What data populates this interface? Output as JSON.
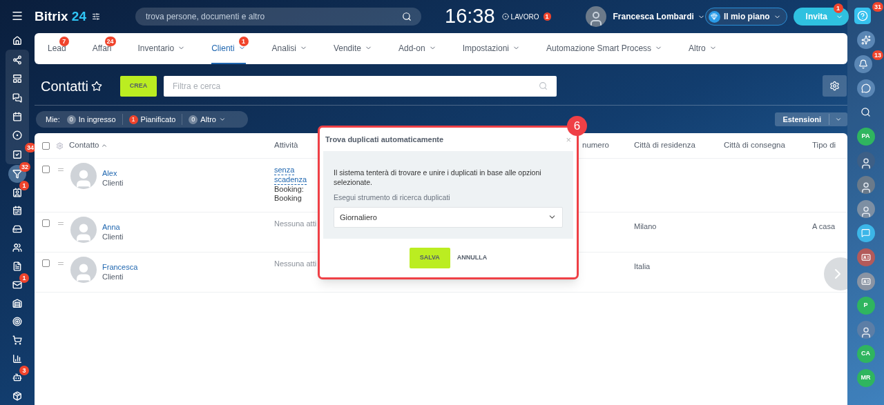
{
  "header": {
    "logo_name": "Bitrix",
    "logo_number": "24",
    "search_placeholder": "trova persone, documenti e altro",
    "clock": "16:38",
    "work_status": {
      "label": "LAVORO",
      "badge": "1"
    },
    "user_name": "Francesca Lombardi",
    "plan_button": "Il mio piano",
    "invite_button": {
      "label": "Invita",
      "badge": "1"
    }
  },
  "left_sidebar": {
    "top": [
      {
        "kind": "home",
        "selected": false
      }
    ],
    "pinned": [
      {
        "kind": "flow",
        "selected": false
      },
      {
        "kind": "board",
        "selected": false
      },
      {
        "kind": "chat",
        "selected": false
      },
      {
        "kind": "calendar",
        "selected": false
      },
      {
        "kind": "circle",
        "selected": false
      },
      {
        "kind": "tasks",
        "badge": "34",
        "selected": false
      }
    ],
    "rest": [
      {
        "kind": "funnel",
        "badge": "32",
        "selected": true
      },
      {
        "kind": "contact",
        "badge": "1",
        "selected": false
      },
      {
        "kind": "schedule",
        "selected": false
      },
      {
        "kind": "drive",
        "selected": false
      },
      {
        "kind": "group",
        "selected": false
      },
      {
        "kind": "doc",
        "selected": false
      },
      {
        "kind": "mail",
        "badge": "1",
        "selected": false
      },
      {
        "kind": "warehouse",
        "selected": false
      },
      {
        "kind": "target",
        "selected": false
      },
      {
        "kind": "cart",
        "selected": false
      },
      {
        "kind": "chart",
        "selected": false
      },
      {
        "kind": "robot",
        "badge": "3",
        "selected": false
      },
      {
        "kind": "box",
        "selected": false
      }
    ]
  },
  "nav_tabs": [
    {
      "label": "Lead",
      "badge": "7",
      "dropdown": false,
      "selected": false
    },
    {
      "label": "Affari",
      "badge": "24",
      "dropdown": false,
      "selected": false
    },
    {
      "label": "Inventario",
      "dropdown": true,
      "selected": false
    },
    {
      "label": "Clienti",
      "badge": "1",
      "dropdown": true,
      "selected": true
    },
    {
      "label": "Analisi",
      "dropdown": true,
      "selected": false
    },
    {
      "label": "Vendite",
      "dropdown": true,
      "selected": false
    },
    {
      "label": "Add-on",
      "dropdown": true,
      "selected": false
    },
    {
      "label": "Impostazioni",
      "dropdown": true,
      "selected": false
    },
    {
      "label": "Automazione Smart Process",
      "dropdown": true,
      "selected": false
    },
    {
      "label": "Altro",
      "dropdown": true,
      "selected": false
    }
  ],
  "toolbar": {
    "title": "Contatti",
    "create_button": "CREA",
    "filter_placeholder": "Filtra e cerca"
  },
  "counters": {
    "label": "Mie:",
    "items": [
      {
        "count": "0",
        "label": "In ingresso",
        "kind": "neutral",
        "dropdown": false
      },
      {
        "count": "1",
        "label": "Pianificato",
        "kind": "alert",
        "dropdown": false
      },
      {
        "count": "0",
        "label": "Altro",
        "kind": "neutral",
        "dropdown": true
      }
    ]
  },
  "extensions_button": "Estensioni",
  "table": {
    "select_all_checked": false,
    "columns": [
      "Contatto",
      "Attività",
      "numero",
      "Città di residenza",
      "Città di consegna",
      "Tipo di"
    ],
    "rows": [
      {
        "checked": false,
        "cells": [
          {
            "name": "Alex",
            "type": "Clienti"
          },
          {
            "links": [
              "senza",
              "scadenza"
            ],
            "text": [
              "Booking:",
              "Booking"
            ]
          },
          "",
          "",
          "",
          ""
        ]
      },
      {
        "checked": false,
        "cells": [
          {
            "name": "Anna",
            "type": "Clienti"
          },
          {
            "note": "Nessuna atti"
          },
          "",
          "Milano",
          "",
          "A casa"
        ]
      },
      {
        "checked": false,
        "cells": [
          {
            "name": "Francesca",
            "type": "Clienti"
          },
          {
            "note": "Nessuna atti"
          },
          "",
          "Italia",
          "",
          ""
        ]
      }
    ]
  },
  "dialog": {
    "title": "Trova duplicati automaticamente",
    "close": "×",
    "description": "Il sistema tenterà di trovare e unire i duplicati in base alle opzioni selezionate.",
    "field_label": "Esegui strumento di ricerca duplicati",
    "field_value": "Giornaliero",
    "save_button": "SALVA",
    "cancel_button": "ANNULLA",
    "annotation": "6"
  },
  "right_rail": [
    {
      "kind": "help",
      "badge": "31"
    },
    {
      "kind": "copilot"
    },
    {
      "kind": "bell",
      "badge": "13"
    },
    {
      "kind": "chat-circle"
    },
    {
      "kind": "search"
    },
    {
      "kind": "initials",
      "text": "PA",
      "color": "#2fb55f"
    },
    {
      "kind": "avatar",
      "color": "#3d5f86"
    },
    {
      "kind": "avatar",
      "color": "#6a7a8a"
    },
    {
      "kind": "avatar",
      "color": "#7d8fa3"
    },
    {
      "kind": "bubble",
      "color": "#3cb6e8"
    },
    {
      "kind": "card",
      "color": "#b35a5a"
    },
    {
      "kind": "card",
      "color": "#8a94a3"
    },
    {
      "kind": "initials",
      "text": "P",
      "color": "#2fb55f"
    },
    {
      "kind": "avatar",
      "color": "#5c7ea6"
    },
    {
      "kind": "initials",
      "text": "CA",
      "color": "#2fb55f"
    },
    {
      "kind": "initials",
      "text": "MR",
      "color": "#2fb55f"
    }
  ]
}
